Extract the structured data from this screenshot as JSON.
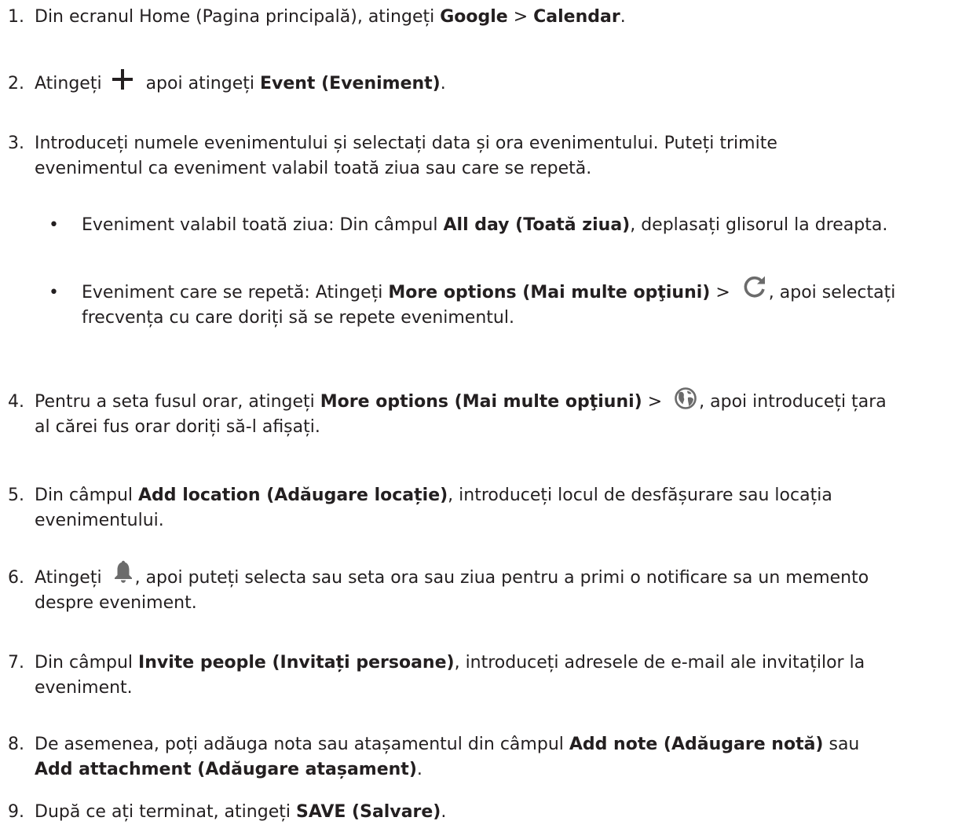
{
  "steps": {
    "s1": {
      "num": "1.",
      "t1": "Din ecranul Home (Pagina principală), atingeți ",
      "b1": "Google",
      "t2": " > ",
      "b2": "Calendar",
      "t3": "."
    },
    "s2": {
      "num": "2.",
      "t1": "Atingeți ",
      "t2": " apoi atingeți ",
      "b1": "Event (Eveniment)",
      "t3": "."
    },
    "s3": {
      "num": "3.",
      "line1": "Introduceți numele evenimentului și selectați data și ora evenimentului. Puteți trimite",
      "line2": "evenimentul ca eveniment valabil toată ziua sau care se repetă."
    },
    "s3a": {
      "bullet": "•",
      "t1": "Eveniment valabil toată ziua: Din câmpul ",
      "b1": "All day (Toată ziua)",
      "t2": ", deplasați glisorul la dreapta."
    },
    "s3b": {
      "bullet": "•",
      "t1": "Eveniment care se repetă: Atingeți ",
      "b1": "More options (Mai multe opţiuni)",
      "t2": " > ",
      "t3": ", apoi selectați",
      "line2": "frecvența cu care doriți să se repete evenimentul."
    },
    "s4": {
      "num": "4.",
      "t1": "Pentru a seta fusul orar, atingeți ",
      "b1": "More options (Mai multe opţiuni)",
      "t2": " > ",
      "t3": ", apoi introduceți țara",
      "line2": "al cărei fus orar doriți să-l afișați."
    },
    "s5": {
      "num": "5.",
      "t1": "Din câmpul ",
      "b1": "Add location (Adăugare locație)",
      "t2": ", introduceți locul de desfășurare sau locația",
      "line2": "evenimentului."
    },
    "s6": {
      "num": "6.",
      "t1": "Atingeți ",
      "t2": ", apoi puteți selecta sau seta ora sau ziua pentru a primi o notificare sa un memento",
      "line2": "despre eveniment."
    },
    "s7": {
      "num": "7.",
      "t1": "Din câmpul ",
      "b1": "Invite people (Invitați persoane)",
      "t2": ", introduceți adresele de e-mail ale invitaților la",
      "line2": "eveniment."
    },
    "s8": {
      "num": "8.",
      "t1": "De asemenea, poți adăuga nota sau atașamentul din câmpul ",
      "b1": "Add note (Adăugare notă)",
      "t2": " sau",
      "b2": "Add attachment (Adăugare atașament)",
      "t3": "."
    },
    "s9": {
      "num": "9.",
      "t1": "După ce ați terminat, atingeți ",
      "b1": "SAVE (Salvare)",
      "t2": "."
    }
  },
  "icons": {
    "plus": "plus-icon",
    "repeat": "refresh-icon",
    "timezone": "globe-icon",
    "reminder": "bell-icon"
  }
}
